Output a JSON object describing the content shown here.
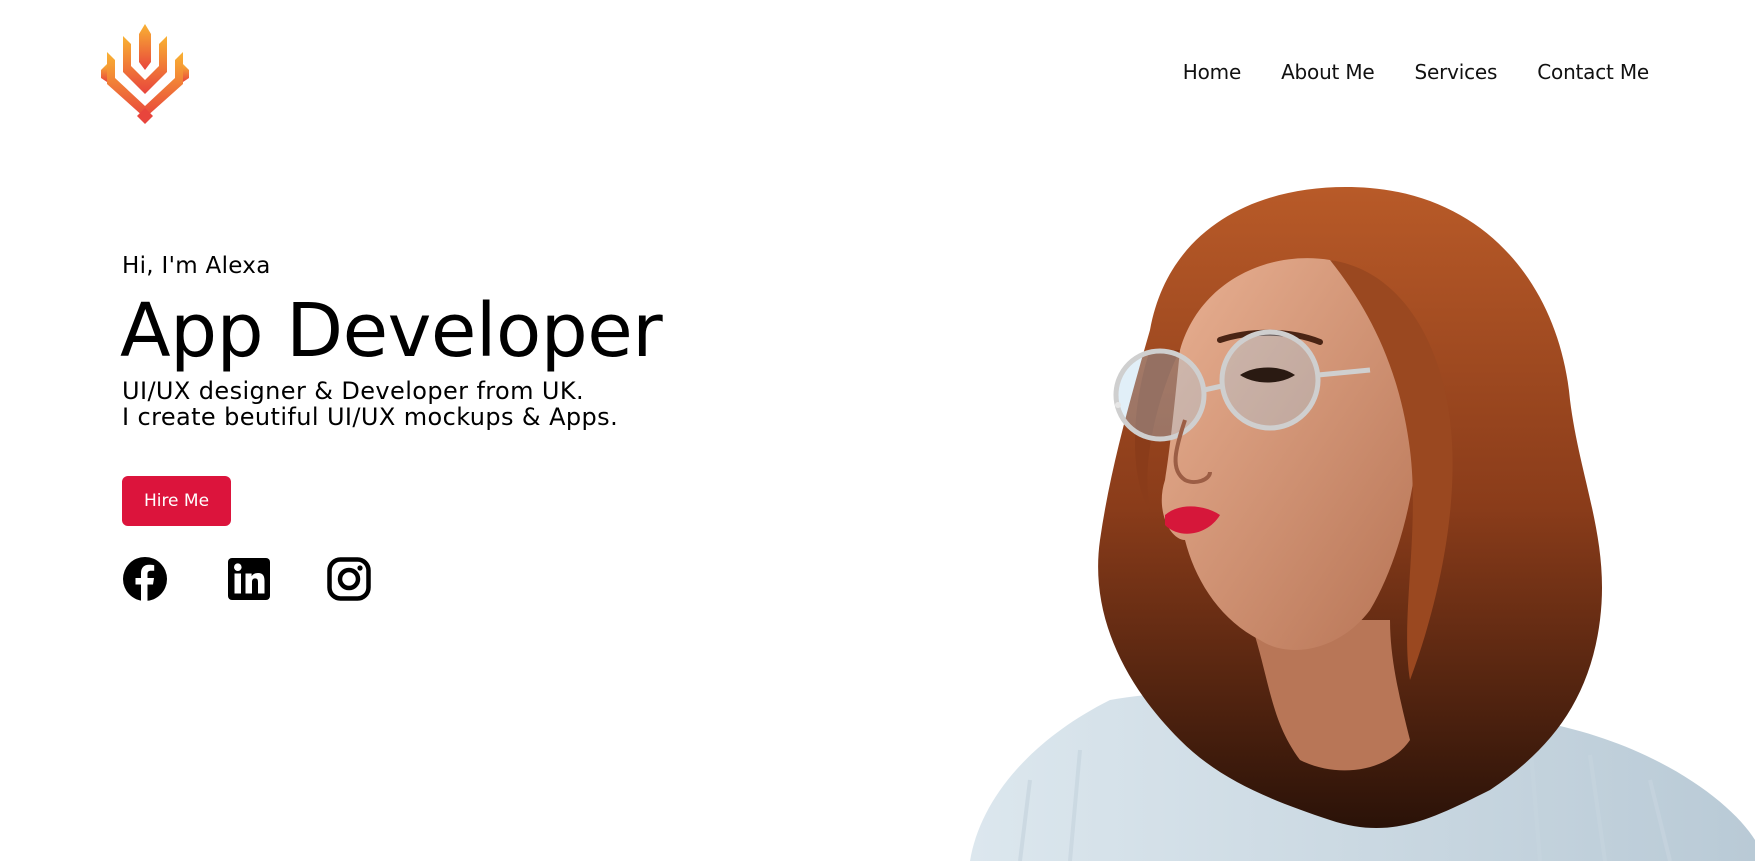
{
  "brand": {
    "logo_icon": "flame-crest-logo",
    "gradient_top": "#f9b233",
    "gradient_bottom": "#e8453c"
  },
  "nav": {
    "items": [
      {
        "label": "Home"
      },
      {
        "label": "About Me"
      },
      {
        "label": "Services"
      },
      {
        "label": "Contact Me"
      }
    ]
  },
  "hero": {
    "greeting": "Hi, I'm Alexa",
    "title": "App Developer",
    "subtitle_line1": "UI/UX designer & Developer from UK.",
    "subtitle_line2": "I create beutiful UI/UX mockups & Apps.",
    "cta_label": "Hire Me",
    "cta_color": "#dc143c"
  },
  "socials": [
    {
      "icon": "facebook-icon"
    },
    {
      "icon": "linkedin-icon"
    },
    {
      "icon": "instagram-icon"
    }
  ],
  "portrait": {
    "icon": "woman-portrait-photo"
  }
}
